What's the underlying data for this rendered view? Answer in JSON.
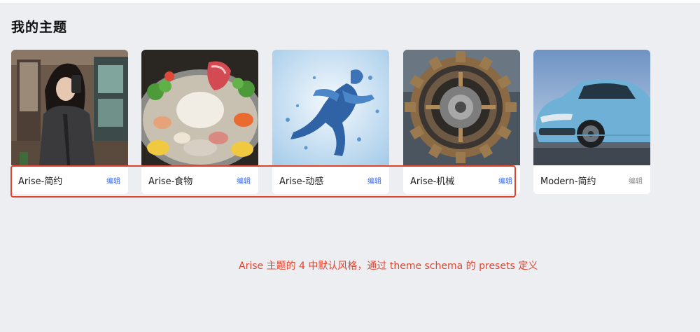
{
  "page": {
    "title": "我的主题"
  },
  "themes": [
    {
      "name": "Arise-简约",
      "edit_label": "编辑",
      "image": "woman-mirror-selfie-photo"
    },
    {
      "name": "Arise-食物",
      "edit_label": "编辑",
      "image": "hotpot-food-photo"
    },
    {
      "name": "Arise-动感",
      "edit_label": "编辑",
      "image": "water-splash-runner-image"
    },
    {
      "name": "Arise-机械",
      "edit_label": "编辑",
      "image": "mechanical-gear-image"
    },
    {
      "name": "Modern-简约",
      "edit_label": "编辑",
      "image": "blue-suv-car-photo"
    }
  ],
  "annotation": {
    "text": "Arise 主题的 4 中默认风格，通过 theme schema 的 presets 定义",
    "color": "#e0452e"
  },
  "colors": {
    "background": "#eceef2",
    "edit_link": "#3c6cf0",
    "edit_link_muted": "#8c8c8c",
    "highlight_border": "#e2412c"
  }
}
